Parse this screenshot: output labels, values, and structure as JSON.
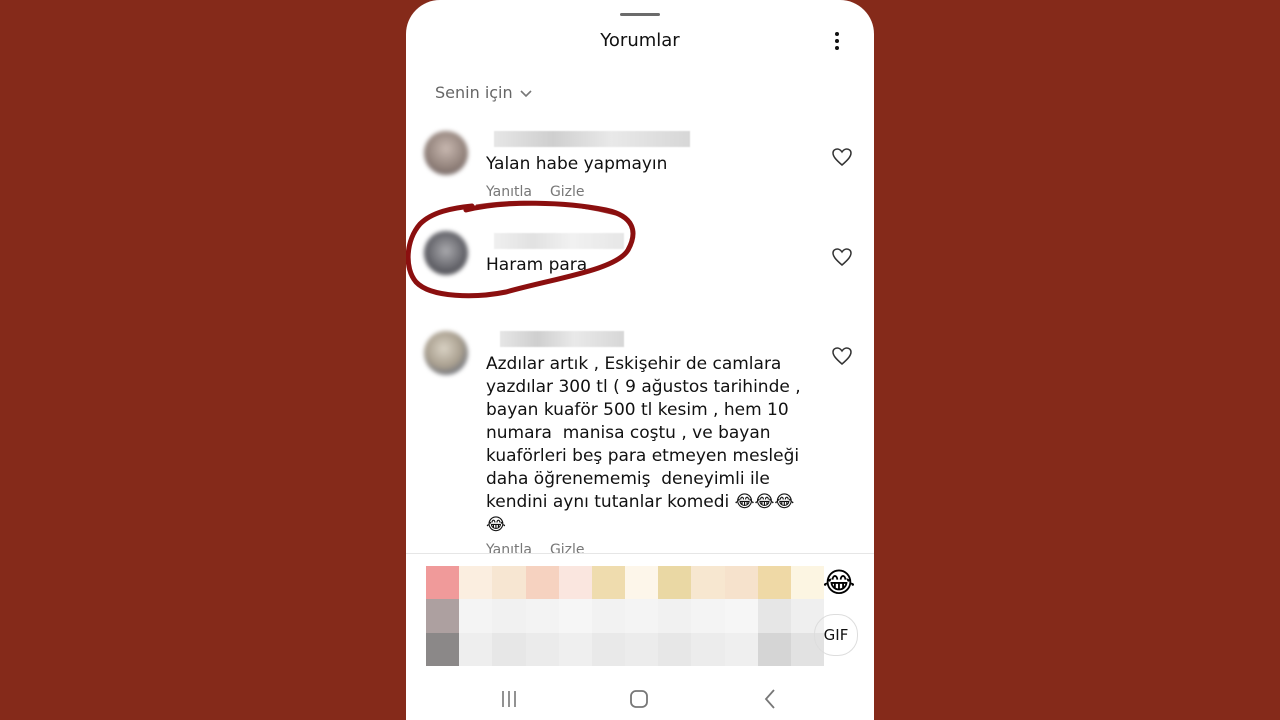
{
  "sheet": {
    "title": "Yorumlar",
    "sort_label": "Senin için"
  },
  "comments": [
    {
      "username": "",
      "text": "Yalan habe yapmayın",
      "reply_label": "Yanıtla",
      "hide_label": "Gizle",
      "highlighted": false
    },
    {
      "username": "",
      "text": "Haram para",
      "reply_label": "",
      "hide_label": "",
      "highlighted": true,
      "annotation_color": "#8b0f0f"
    },
    {
      "username": "",
      "text": "Azdılar artık , Eskişehir de camlara yazdılar 300 tl ( 9 ağustos tarihinde , bayan kuaför 500 tl kesim , hem 10 numara  manisa coştu , ve bayan kuaförleri beş para etmeyen mesleği daha öğrenememiş  deneyimli ile kendini aynı tutanlar komedi 😂😂😂\n😂",
      "reply_label": "Yanıtla",
      "hide_label": "Gizle",
      "highlighted": false
    }
  ],
  "composer": {
    "emoji": "😂",
    "gif_label": "GIF"
  },
  "icons": {
    "more": "more-vertical-icon",
    "sort_chevron": "chevron-down-icon",
    "like": "heart-outline-icon",
    "nav_recents": "recents-icon",
    "nav_home": "home-icon",
    "nav_back": "back-icon"
  },
  "colors": {
    "background": "#852a1a",
    "sheet": "#ffffff",
    "annotation": "#8b0f0f",
    "secondary_text": "#777777"
  }
}
